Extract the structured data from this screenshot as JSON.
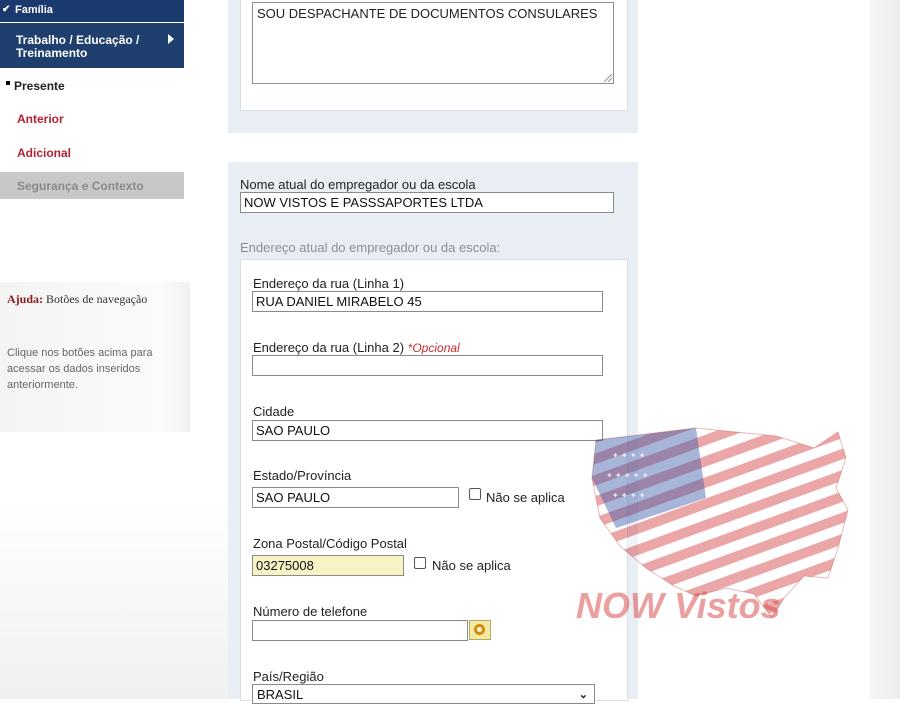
{
  "sidebar": {
    "familia": "Família",
    "familia_check": "✔",
    "trabalho": "Trabalho / Educação / Treinamento",
    "presente": "Presente",
    "anterior": "Anterior",
    "adicional": "Adicional",
    "seguranca": "Segurança e Contexto"
  },
  "help": {
    "title_bold": "Ajuda:",
    "title_rest": "Botões de navegação",
    "text": "Clique nos botões acima para acessar os dados inseridos anteriormente."
  },
  "form": {
    "duties_text": "SOU DESPACHANTE DE DOCUMENTOS CONSULARES",
    "employer_name_label": "Nome atual do empregador ou da escola",
    "employer_name_value": "NOW VISTOS E PASSSAPORTES LTDA",
    "address_heading": "Endereço atual do empregador ou da escola:",
    "street1_label": "Endereço da rua (Linha 1)",
    "street1_value": "RUA DANIEL MIRABELO 45",
    "street2_label": "Endereço da rua (Linha 2)",
    "street2_optional": "*Opcional",
    "street2_value": "",
    "city_label": "Cidade",
    "city_value": "SAO PAULO",
    "state_label": "Estado/Província",
    "state_value": "SAO PAULO",
    "state_na": "Não se aplica",
    "postal_label": "Zona Postal/Código Postal",
    "postal_value": "03275008",
    "postal_na": "Não se aplica",
    "phone_label": "Número de telefone",
    "phone_value": "",
    "country_label": "País/Região",
    "country_value": "BRASIL"
  },
  "watermark": {
    "text": "NOW Vistos",
    "color": "#dc5050"
  }
}
